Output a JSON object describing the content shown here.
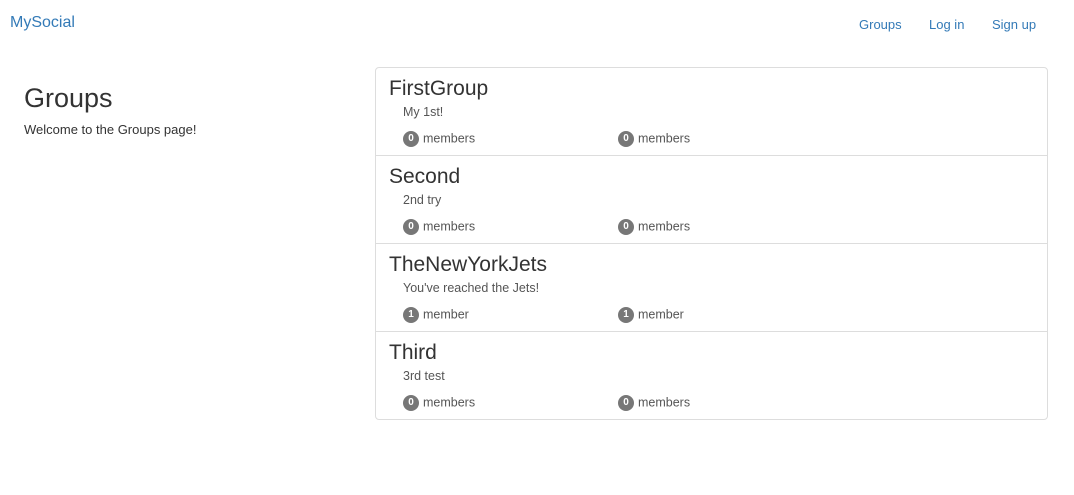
{
  "nav": {
    "brand": "MySocial",
    "links": [
      {
        "label": "Groups"
      },
      {
        "label": "Log in"
      },
      {
        "label": "Sign up"
      }
    ]
  },
  "sidebar": {
    "title": "Groups",
    "welcome": "Welcome to the Groups page!"
  },
  "groups": [
    {
      "name": "FirstGroup",
      "description": "My 1st!",
      "stats": [
        {
          "count": "0",
          "label": "members"
        },
        {
          "count": "0",
          "label": "members"
        }
      ]
    },
    {
      "name": "Second",
      "description": "2nd try",
      "stats": [
        {
          "count": "0",
          "label": "members"
        },
        {
          "count": "0",
          "label": "members"
        }
      ]
    },
    {
      "name": "TheNewYorkJets",
      "description": "You've reached the Jets!",
      "stats": [
        {
          "count": "1",
          "label": "member"
        },
        {
          "count": "1",
          "label": "member"
        }
      ]
    },
    {
      "name": "Third",
      "description": "3rd test",
      "stats": [
        {
          "count": "0",
          "label": "members"
        },
        {
          "count": "0",
          "label": "members"
        }
      ]
    }
  ],
  "colors": {
    "link": "#337ab7",
    "badge": "#777777",
    "border": "#dddddd"
  }
}
